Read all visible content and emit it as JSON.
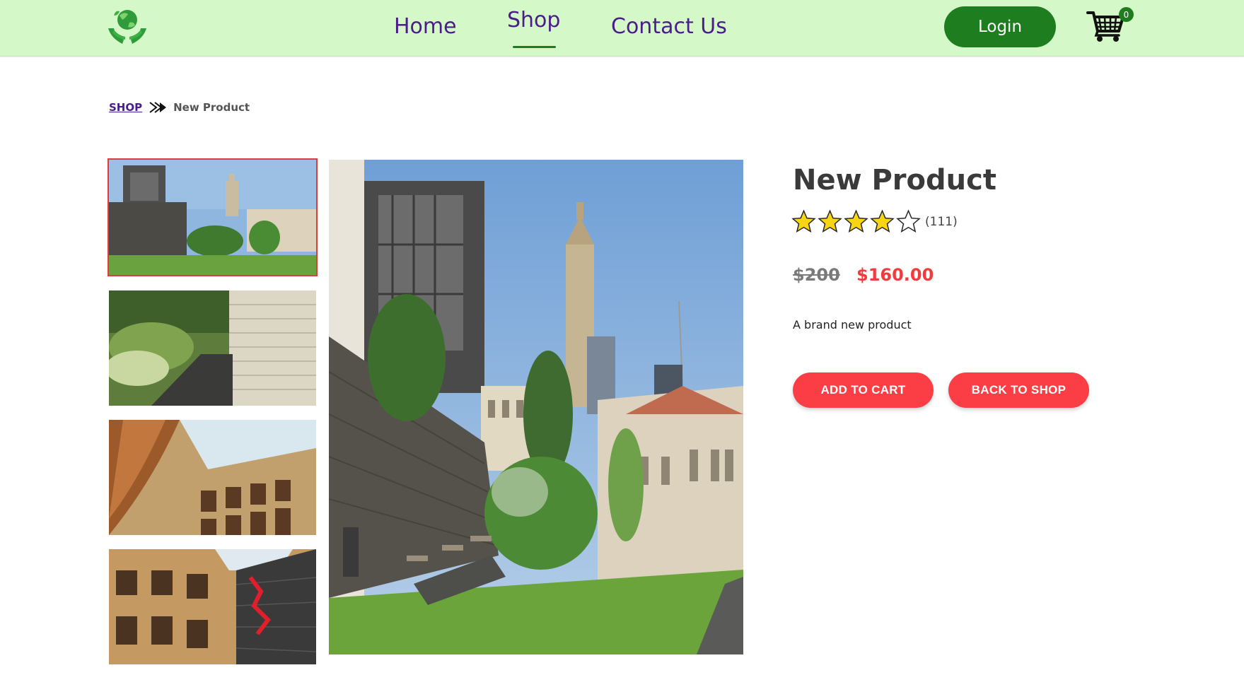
{
  "navbar": {
    "links": [
      "Home",
      "Shop",
      "Contact Us"
    ],
    "active": "Shop",
    "login_label": "Login",
    "cart_count": "0"
  },
  "breadcrumb": {
    "parent": "SHOP",
    "current": "New Product"
  },
  "product": {
    "title": "New Product",
    "rating": 4,
    "rating_max": 5,
    "review_count": "(111)",
    "old_price": "$200",
    "price": "$160.00",
    "description": "A brand new product",
    "add_to_cart_label": "ADD TO CART",
    "back_to_shop_label": "BACK TO SHOP",
    "thumbnail_count": 4,
    "selected_thumbnail": 1
  },
  "colors": {
    "nav_bg": "#d5f8c9",
    "nav_link": "#4b1d8c",
    "brand_green": "#1e7d1e",
    "accent_red": "#fb3d45",
    "star_fill": "#f7d414"
  }
}
